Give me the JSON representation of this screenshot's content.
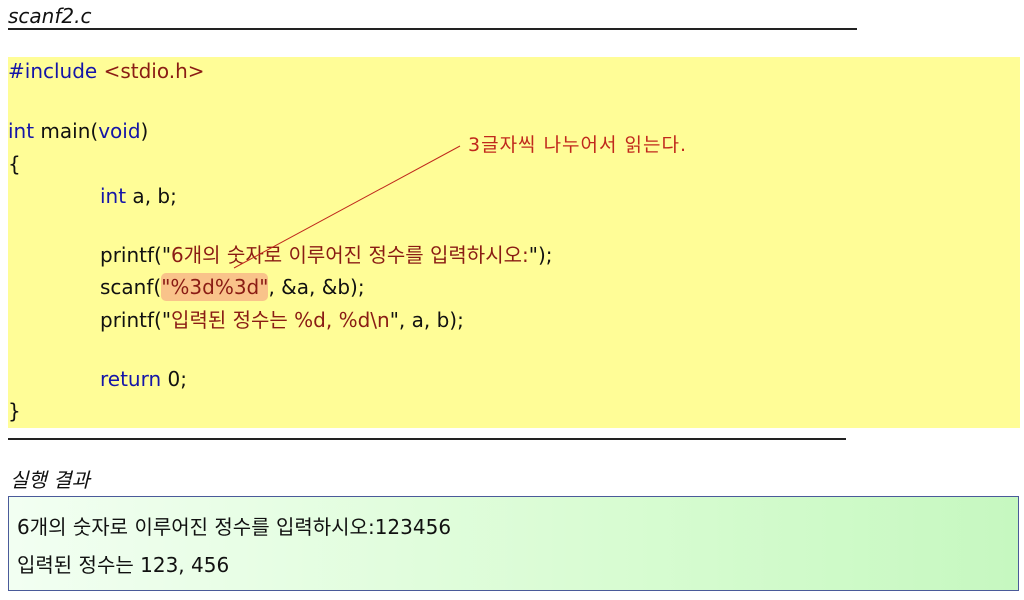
{
  "file_title": "scanf2.c",
  "code": {
    "line1": {
      "kw": "#include",
      "rest": "<stdio.h>"
    },
    "line2": {
      "kw1": "int",
      "mid": " main(",
      "kw2": "void",
      "end": ")"
    },
    "line3": "{",
    "line4": {
      "kw": "int",
      "rest": " a, b;"
    },
    "line5": {
      "pre": "printf(\"",
      "str": "6개의 숫자로 이루어진 정수를 입력하시오:",
      "post": "\");"
    },
    "line6": {
      "pre": "scanf(",
      "hl": "\"%3d%3d\"",
      "post": ", &a, &b);"
    },
    "line7": {
      "pre": "printf(\"",
      "str": "입력된 정수는 %d, %d\\n",
      "post": "\", a, b);"
    },
    "line8": {
      "kw": "return",
      "rest": " 0;"
    },
    "line9": "}"
  },
  "annotation": "3글자씩 나누어서 읽는다.",
  "result_title": "실행 결과",
  "result": {
    "line1": "6개의 숫자로 이루어진 정수를 입력하시오:123456",
    "line2": "입력된 정수는 123, 456"
  }
}
